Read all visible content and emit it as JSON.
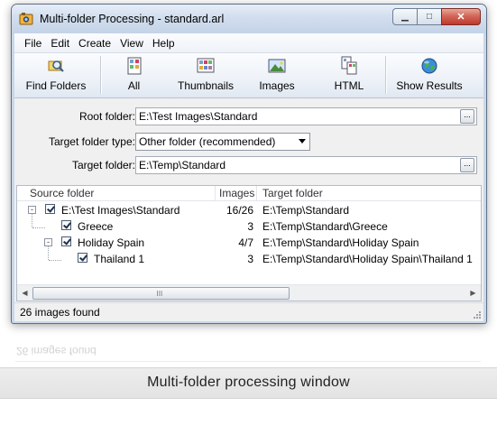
{
  "window": {
    "title": "Multi-folder Processing - standard.arl",
    "buttons": [
      "minimize",
      "maximize",
      "close"
    ]
  },
  "menu": [
    "File",
    "Edit",
    "Create",
    "View",
    "Help"
  ],
  "toolbar": [
    {
      "label": "Find Folders",
      "icon": "find-folders-icon"
    },
    {
      "label": "All",
      "icon": "all-icon"
    },
    {
      "label": "Thumbnails",
      "icon": "thumbnails-icon"
    },
    {
      "label": "Images",
      "icon": "images-icon"
    },
    {
      "label": "HTML",
      "icon": "html-icon"
    },
    {
      "label": "Show Results",
      "icon": "globe-icon"
    }
  ],
  "form": {
    "root_folder_label": "Root folder:",
    "root_folder_value": "E:\\Test Images\\Standard",
    "target_type_label": "Target folder type:",
    "target_type_value": "Other folder (recommended)",
    "target_folder_label": "Target folder:",
    "target_folder_value": "E:\\Temp\\Standard",
    "browse_label": "..."
  },
  "tree": {
    "columns": [
      "Source folder",
      "Images",
      "Target folder"
    ],
    "rows": [
      {
        "name": "E:\\Test Images\\Standard",
        "images": "16/26",
        "target": "E:\\Temp\\Standard",
        "checked": true,
        "level": 0,
        "expander": "-"
      },
      {
        "name": "Greece",
        "images": "3",
        "target": "E:\\Temp\\Standard\\Greece",
        "checked": true,
        "level": 1,
        "expander": ""
      },
      {
        "name": "Holiday Spain",
        "images": "4/7",
        "target": "E:\\Temp\\Standard\\Holiday Spain",
        "checked": true,
        "level": 1,
        "expander": "-"
      },
      {
        "name": "Thailand  1",
        "images": "3",
        "target": "E:\\Temp\\Standard\\Holiday Spain\\Thailand  1",
        "checked": true,
        "level": 2,
        "expander": ""
      }
    ],
    "scroll_grip": "III"
  },
  "status": "26 images found",
  "reflection_status": "26 images found",
  "caption": "Multi-folder processing window",
  "colors": {
    "accent": "#c9d7e8",
    "close_button": "#c0392b"
  }
}
